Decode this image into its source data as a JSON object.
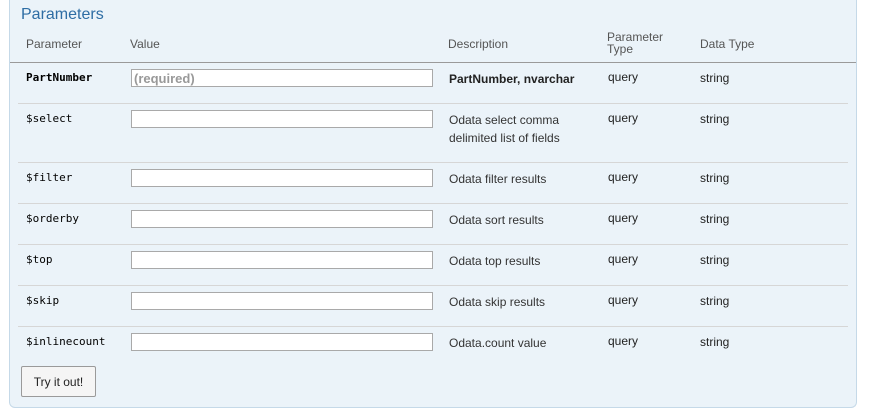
{
  "section": {
    "title": "Parameters"
  },
  "columns": {
    "parameter": "Parameter",
    "value": "Value",
    "description": "Description",
    "parameter_type_line1": "Parameter",
    "parameter_type_line2": "Type",
    "data_type": "Data Type"
  },
  "params": [
    {
      "name": "PartNumber",
      "placeholder": "(required)",
      "value": "",
      "description": "PartNumber, nvarchar",
      "param_type": "query",
      "data_type": "string",
      "required": true
    },
    {
      "name": "$select",
      "placeholder": "",
      "value": "",
      "description": "Odata select comma delimited list of fields",
      "param_type": "query",
      "data_type": "string",
      "required": false
    },
    {
      "name": "$filter",
      "placeholder": "",
      "value": "",
      "description": "Odata filter results",
      "param_type": "query",
      "data_type": "string",
      "required": false
    },
    {
      "name": "$orderby",
      "placeholder": "",
      "value": "",
      "description": "Odata sort results",
      "param_type": "query",
      "data_type": "string",
      "required": false
    },
    {
      "name": "$top",
      "placeholder": "",
      "value": "",
      "description": "Odata top results",
      "param_type": "query",
      "data_type": "string",
      "required": false
    },
    {
      "name": "$skip",
      "placeholder": "",
      "value": "",
      "description": "Odata skip results",
      "param_type": "query",
      "data_type": "string",
      "required": false
    },
    {
      "name": "$inlinecount",
      "placeholder": "",
      "value": "",
      "description": "Odata.count value",
      "param_type": "query",
      "data_type": "string",
      "required": false
    }
  ],
  "actions": {
    "try_label": "Try it out!"
  }
}
